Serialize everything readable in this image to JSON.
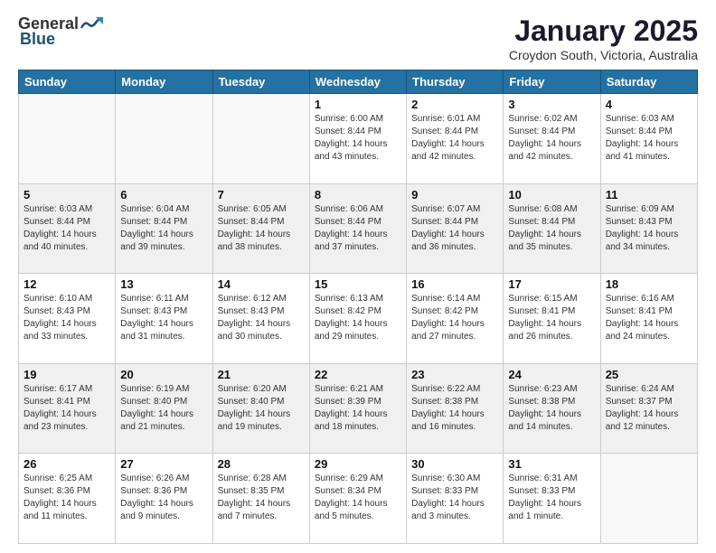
{
  "logo": {
    "general": "General",
    "blue": "Blue"
  },
  "title": "January 2025",
  "subtitle": "Croydon South, Victoria, Australia",
  "days_of_week": [
    "Sunday",
    "Monday",
    "Tuesday",
    "Wednesday",
    "Thursday",
    "Friday",
    "Saturday"
  ],
  "weeks": [
    [
      {
        "day": "",
        "info": ""
      },
      {
        "day": "",
        "info": ""
      },
      {
        "day": "",
        "info": ""
      },
      {
        "day": "1",
        "info": "Sunrise: 6:00 AM\nSunset: 8:44 PM\nDaylight: 14 hours\nand 43 minutes."
      },
      {
        "day": "2",
        "info": "Sunrise: 6:01 AM\nSunset: 8:44 PM\nDaylight: 14 hours\nand 42 minutes."
      },
      {
        "day": "3",
        "info": "Sunrise: 6:02 AM\nSunset: 8:44 PM\nDaylight: 14 hours\nand 42 minutes."
      },
      {
        "day": "4",
        "info": "Sunrise: 6:03 AM\nSunset: 8:44 PM\nDaylight: 14 hours\nand 41 minutes."
      }
    ],
    [
      {
        "day": "5",
        "info": "Sunrise: 6:03 AM\nSunset: 8:44 PM\nDaylight: 14 hours\nand 40 minutes."
      },
      {
        "day": "6",
        "info": "Sunrise: 6:04 AM\nSunset: 8:44 PM\nDaylight: 14 hours\nand 39 minutes."
      },
      {
        "day": "7",
        "info": "Sunrise: 6:05 AM\nSunset: 8:44 PM\nDaylight: 14 hours\nand 38 minutes."
      },
      {
        "day": "8",
        "info": "Sunrise: 6:06 AM\nSunset: 8:44 PM\nDaylight: 14 hours\nand 37 minutes."
      },
      {
        "day": "9",
        "info": "Sunrise: 6:07 AM\nSunset: 8:44 PM\nDaylight: 14 hours\nand 36 minutes."
      },
      {
        "day": "10",
        "info": "Sunrise: 6:08 AM\nSunset: 8:44 PM\nDaylight: 14 hours\nand 35 minutes."
      },
      {
        "day": "11",
        "info": "Sunrise: 6:09 AM\nSunset: 8:43 PM\nDaylight: 14 hours\nand 34 minutes."
      }
    ],
    [
      {
        "day": "12",
        "info": "Sunrise: 6:10 AM\nSunset: 8:43 PM\nDaylight: 14 hours\nand 33 minutes."
      },
      {
        "day": "13",
        "info": "Sunrise: 6:11 AM\nSunset: 8:43 PM\nDaylight: 14 hours\nand 31 minutes."
      },
      {
        "day": "14",
        "info": "Sunrise: 6:12 AM\nSunset: 8:43 PM\nDaylight: 14 hours\nand 30 minutes."
      },
      {
        "day": "15",
        "info": "Sunrise: 6:13 AM\nSunset: 8:42 PM\nDaylight: 14 hours\nand 29 minutes."
      },
      {
        "day": "16",
        "info": "Sunrise: 6:14 AM\nSunset: 8:42 PM\nDaylight: 14 hours\nand 27 minutes."
      },
      {
        "day": "17",
        "info": "Sunrise: 6:15 AM\nSunset: 8:41 PM\nDaylight: 14 hours\nand 26 minutes."
      },
      {
        "day": "18",
        "info": "Sunrise: 6:16 AM\nSunset: 8:41 PM\nDaylight: 14 hours\nand 24 minutes."
      }
    ],
    [
      {
        "day": "19",
        "info": "Sunrise: 6:17 AM\nSunset: 8:41 PM\nDaylight: 14 hours\nand 23 minutes."
      },
      {
        "day": "20",
        "info": "Sunrise: 6:19 AM\nSunset: 8:40 PM\nDaylight: 14 hours\nand 21 minutes."
      },
      {
        "day": "21",
        "info": "Sunrise: 6:20 AM\nSunset: 8:40 PM\nDaylight: 14 hours\nand 19 minutes."
      },
      {
        "day": "22",
        "info": "Sunrise: 6:21 AM\nSunset: 8:39 PM\nDaylight: 14 hours\nand 18 minutes."
      },
      {
        "day": "23",
        "info": "Sunrise: 6:22 AM\nSunset: 8:38 PM\nDaylight: 14 hours\nand 16 minutes."
      },
      {
        "day": "24",
        "info": "Sunrise: 6:23 AM\nSunset: 8:38 PM\nDaylight: 14 hours\nand 14 minutes."
      },
      {
        "day": "25",
        "info": "Sunrise: 6:24 AM\nSunset: 8:37 PM\nDaylight: 14 hours\nand 12 minutes."
      }
    ],
    [
      {
        "day": "26",
        "info": "Sunrise: 6:25 AM\nSunset: 8:36 PM\nDaylight: 14 hours\nand 11 minutes."
      },
      {
        "day": "27",
        "info": "Sunrise: 6:26 AM\nSunset: 8:36 PM\nDaylight: 14 hours\nand 9 minutes."
      },
      {
        "day": "28",
        "info": "Sunrise: 6:28 AM\nSunset: 8:35 PM\nDaylight: 14 hours\nand 7 minutes."
      },
      {
        "day": "29",
        "info": "Sunrise: 6:29 AM\nSunset: 8:34 PM\nDaylight: 14 hours\nand 5 minutes."
      },
      {
        "day": "30",
        "info": "Sunrise: 6:30 AM\nSunset: 8:33 PM\nDaylight: 14 hours\nand 3 minutes."
      },
      {
        "day": "31",
        "info": "Sunrise: 6:31 AM\nSunset: 8:33 PM\nDaylight: 14 hours\nand 1 minute."
      },
      {
        "day": "",
        "info": ""
      }
    ]
  ]
}
